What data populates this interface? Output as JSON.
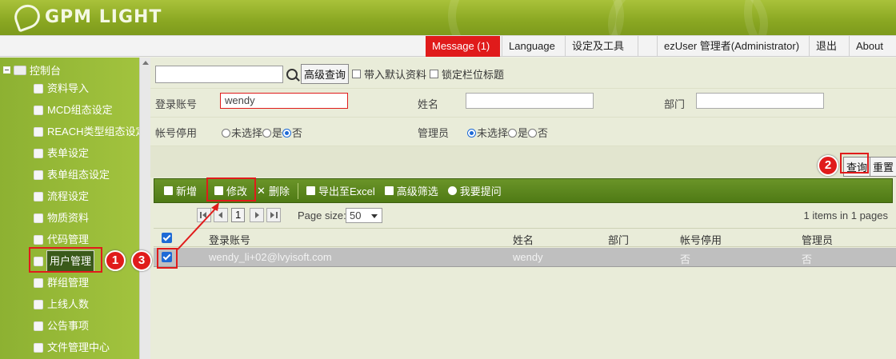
{
  "brand": {
    "logo_text": "GPM LIGHT"
  },
  "topnav": {
    "message": "Message (1)",
    "language": "Language",
    "settings": "设定及工具",
    "user": "ezUser 管理者(Administrator)",
    "logout": "退出",
    "about": "About"
  },
  "sidebar": {
    "root": "控制台",
    "items": [
      {
        "label": "资料导入",
        "icon": "import-icon"
      },
      {
        "label": "MCD组态设定",
        "icon": "config-icon"
      },
      {
        "label": "REACH类型组态设定",
        "icon": "config-icon"
      },
      {
        "label": "表单设定",
        "icon": "form-icon"
      },
      {
        "label": "表单组态设定",
        "icon": "form-config-icon"
      },
      {
        "label": "流程设定",
        "icon": "flow-icon"
      },
      {
        "label": "物质资料",
        "icon": "substance-icon"
      },
      {
        "label": "代码管理",
        "icon": "code-icon"
      },
      {
        "label": "用户管理",
        "icon": "user-icon"
      },
      {
        "label": "群组管理",
        "icon": "group-icon"
      },
      {
        "label": "上线人数",
        "icon": "online-icon"
      },
      {
        "label": "公告事项",
        "icon": "notice-icon"
      },
      {
        "label": "文件管理中心",
        "icon": "file-icon"
      }
    ]
  },
  "search": {
    "value": "",
    "advanced_query": "高级查询",
    "include_default": "带入默认资料",
    "lock_header": "锁定栏位标题"
  },
  "filters": {
    "login_label": "登录账号",
    "login_value": "wendy",
    "name_label": "姓名",
    "name_value": "",
    "dept_label": "部门",
    "dept_value": "",
    "disabled_label": "帐号停用",
    "admin_label": "管理员",
    "opt_none": "未选择",
    "opt_yes": "是",
    "opt_no": "否",
    "disabled_selected": "否",
    "admin_selected": "未选择"
  },
  "actions": {
    "query": "查询",
    "reset": "重置"
  },
  "toolbar": {
    "add": "新增",
    "edit": "修改",
    "delete": "删除",
    "export": "导出至Excel",
    "filter": "高级筛选",
    "help": "我要提问"
  },
  "pager": {
    "page": "1",
    "page_size_label": "Page size:",
    "page_size": "50",
    "summary": "1 items in 1 pages"
  },
  "grid": {
    "headers": [
      "登录账号",
      "姓名",
      "部门",
      "帐号停用",
      "管理员"
    ],
    "rows": [
      {
        "login": "wendy_li+02@lvyisoft.com",
        "name": "wendy",
        "dept": "",
        "disabled": "否",
        "admin": "否"
      }
    ]
  },
  "annotations": {
    "step1": "1",
    "step2": "2",
    "step3": "3"
  },
  "colors": {
    "accent_red": "#e01b1b",
    "brand_green": "#8aa722",
    "toolbar_green": "#4f7a15"
  }
}
